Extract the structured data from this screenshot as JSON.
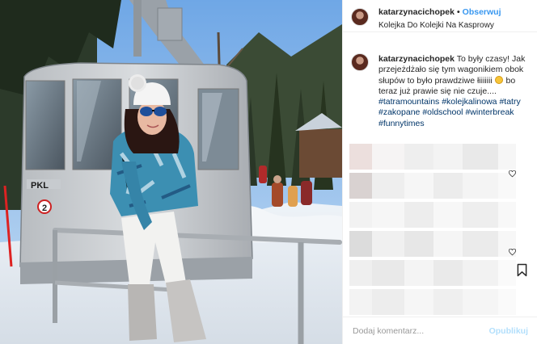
{
  "header": {
    "username": "katarzynacichopek",
    "separator": "•",
    "follow_label": "Obserwuj",
    "location": "Kolejka Do Kolejki Na Kasprowy"
  },
  "caption": {
    "username": "katarzynacichopek",
    "text_part1": "To były czasy! Jak przejeżdżało się tym wagonikiem obok słupów to było prawdziwe łiiiiiii",
    "text_part2": "bo teraz już prawie się nie czuje....",
    "hashtags": [
      "#tatramountains",
      "#kolejkalinowa",
      "#tatry",
      "#zakopane",
      "#oldschool",
      "#winterbreak",
      "#funnytimes"
    ]
  },
  "photo": {
    "gondola_sign": "PKL",
    "gondola_number": "2"
  },
  "comment": {
    "placeholder": "Dodaj komentarz...",
    "publish_label": "Opublikuj"
  },
  "icons": {
    "heart": "heart-icon",
    "bookmark": "bookmark-icon",
    "emoji": "grinning-face-icon"
  },
  "colors": {
    "link_blue": "#3897f0",
    "hashtag": "#003569",
    "text": "#262626",
    "muted": "#999999",
    "publish_disabled": "#b2dffc"
  }
}
